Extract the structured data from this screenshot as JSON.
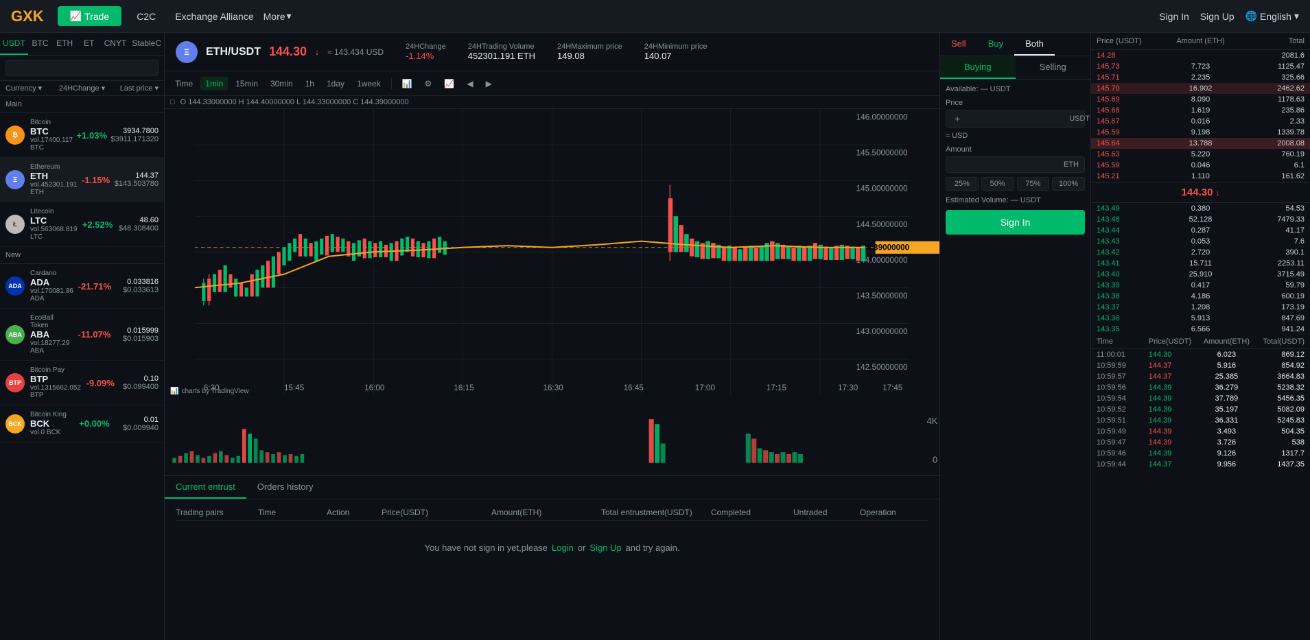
{
  "header": {
    "logo": "GXK",
    "nav": {
      "trade": "Trade",
      "c2c": "C2C",
      "exchange_alliance": "Exchange Alliance",
      "more": "More"
    },
    "right": {
      "sign_in": "Sign In",
      "sign_up": "Sign Up",
      "language": "English"
    }
  },
  "sidebar": {
    "tabs": [
      "USDT",
      "BTC",
      "ETH",
      "ET",
      "CNYT",
      "StableC"
    ],
    "active_tab": "USDT",
    "search_placeholder": "",
    "col_headers": [
      "Currency",
      "24HChange",
      "Last price"
    ],
    "section_main": "Main",
    "section_new": "New",
    "coins": [
      {
        "name": "Bitcoin",
        "ticker": "BTC",
        "change": "+1.03%",
        "change_type": "pos",
        "price1": "3934.7800",
        "price2": "$3911.171320",
        "vol": "vol.17400.117 BTC",
        "color": "#f7931a"
      },
      {
        "name": "Ethereum",
        "ticker": "ETH",
        "change": "-1.15%",
        "change_type": "neg",
        "price1": "144.37",
        "price2": "$143.503780",
        "vol": "vol.452301.191 ETH",
        "color": "#627eea"
      },
      {
        "name": "Litecoin",
        "ticker": "LTC",
        "change": "+2.52%",
        "change_type": "pos",
        "price1": "48.60",
        "price2": "$48.308400",
        "vol": "vol.563068.819 LTC",
        "color": "#bfbbbb"
      }
    ],
    "new_coins": [
      {
        "name": "Cardano",
        "ticker": "ADA",
        "change": "-21.71%",
        "change_type": "neg",
        "price1": "0.033816",
        "price2": "$0.033613",
        "vol": "vol.170081.86 ADA",
        "color": "#0033ad"
      },
      {
        "name": "EcoBall Token",
        "ticker": "ABA",
        "change": "-11.07%",
        "change_type": "neg",
        "price1": "0.015999",
        "price2": "$0.015903",
        "vol": "vol.18277.29 ABA",
        "color": "#4caf50"
      },
      {
        "name": "Bitcoin Pay",
        "ticker": "BTP",
        "change": "-9.09%",
        "change_type": "neg",
        "price1": "0.10",
        "price2": "$0.099400",
        "vol": "vol.1315662.052 BTP",
        "color": "#e84142"
      },
      {
        "name": "Bitcoin King",
        "ticker": "BCK",
        "change": "+0.00%",
        "change_type": "pos",
        "price1": "0.01",
        "price2": "$0.009940",
        "vol": "vol.0 BCK",
        "color": "#f5a623"
      }
    ]
  },
  "chart_header": {
    "pair": "ETH/USDT",
    "price": "144.30",
    "price_arrow": "↓",
    "approx": "≈ 143.434 USD",
    "stats": {
      "change_label": "24HChange",
      "change_val": "-1.14%",
      "vol_label": "24HTrading Volume",
      "vol_val": "452301.191 ETH",
      "max_label": "24HMaximum price",
      "max_val": "149.08",
      "min_label": "24HMinimum price",
      "min_val": "140.07"
    }
  },
  "chart_toolbar": {
    "time_label": "Time",
    "intervals": [
      "1min",
      "15min",
      "30min",
      "1h",
      "1day",
      "1week"
    ],
    "active_interval": "1min",
    "ohlc": "O 144.33000000  H 144.40000000  L 144.33000000  C 144.39000000"
  },
  "trade_form": {
    "tabs": [
      "Sell",
      "Buy",
      "Both"
    ],
    "active_tab": "Both",
    "buying_label": "Buying",
    "selling_label": "Selling",
    "active_side": "Buying",
    "available_label": "Available:",
    "available_val": "— USDT",
    "price_label": "Price",
    "price_unit": "USDT",
    "approx_label": "≈ USD",
    "amount_label": "Amount",
    "amount_unit": "ETH",
    "pct_btns": [
      "25%",
      "50%",
      "75%",
      "100%"
    ],
    "est_label": "Estimated Volume:",
    "est_val": "— USDT",
    "sign_in_btn": "Sign In"
  },
  "order_book": {
    "col_headers": [
      "Price (USDT)",
      "Amount (ETH)",
      "Total"
    ],
    "asks": [
      {
        "price": "145.73",
        "amount": "7.723",
        "total": "1125.47"
      },
      {
        "price": "145.71",
        "amount": "2.235",
        "total": "325.66"
      },
      {
        "price": "145.70",
        "amount": "16.902",
        "total": "2462.62"
      },
      {
        "price": "145.69",
        "amount": "8.090",
        "total": "1178.63"
      },
      {
        "price": "145.68",
        "amount": "1.619",
        "total": "235.86"
      },
      {
        "price": "145.67",
        "amount": "0.016",
        "total": "2.33"
      },
      {
        "price": "145.59",
        "amount": "9.198",
        "total": "1339.78"
      },
      {
        "price": "145.64",
        "amount": "13.788",
        "total": "2008.08"
      },
      {
        "price": "145.63",
        "amount": "5.220",
        "total": "760.19"
      },
      {
        "price": "145.59",
        "amount": "0.046",
        "total": "6.1"
      },
      {
        "price": "145.21",
        "amount": "1.110",
        "total": "161.62"
      },
      {
        "price": "14.28",
        "amount": "",
        "total": "2081.6"
      }
    ],
    "mid_price": "144.30",
    "mid_arrow": "↓",
    "bids": [
      {
        "price": "143.49",
        "amount": "0.380",
        "total": "54.53"
      },
      {
        "price": "143.48",
        "amount": "52.128",
        "total": "7479.33"
      },
      {
        "price": "143.44",
        "amount": "0.287",
        "total": "41.17"
      },
      {
        "price": "143.43",
        "amount": "0.053",
        "total": "7.6"
      },
      {
        "price": "143.42",
        "amount": "2.720",
        "total": "390.1"
      },
      {
        "price": "143.41",
        "amount": "15.711",
        "total": "2253.11"
      },
      {
        "price": "143.40",
        "amount": "25.910",
        "total": "3715.49"
      },
      {
        "price": "143.39",
        "amount": "0.417",
        "total": "59.79"
      },
      {
        "price": "143.38",
        "amount": "4.186",
        "total": "600.19"
      },
      {
        "price": "143.37",
        "amount": "1.208",
        "total": "173.19"
      },
      {
        "price": "143.36",
        "amount": "5.913",
        "total": "847.69"
      },
      {
        "price": "143.35",
        "amount": "6.566",
        "total": "941.24"
      }
    ],
    "trade_history_headers": [
      "Time",
      "Price(USDT)",
      "Amount(ETH)",
      "Total(USDT)"
    ],
    "trades": [
      {
        "time": "11:00:01",
        "price": "144.30",
        "amount": "6.023",
        "total": "869.12",
        "type": "buy"
      },
      {
        "time": "10:59:59",
        "price": "144.37",
        "amount": "5.916",
        "total": "854.92",
        "type": "sell"
      },
      {
        "time": "10:59:57",
        "price": "144.37",
        "amount": "25.385",
        "total": "3664.83",
        "type": "sell"
      },
      {
        "time": "10:59:56",
        "price": "144.39",
        "amount": "36.279",
        "total": "5238.32",
        "type": "buy"
      },
      {
        "time": "10:59:54",
        "price": "144.39",
        "amount": "37.789",
        "total": "5456.35",
        "type": "buy"
      },
      {
        "time": "10:59:52",
        "price": "144.39",
        "amount": "35.197",
        "total": "5082.09",
        "type": "buy"
      },
      {
        "time": "10:59:51",
        "price": "144.39",
        "amount": "36.331",
        "total": "5245.83",
        "type": "buy"
      },
      {
        "time": "10:59:49",
        "price": "144.39",
        "amount": "3.493",
        "total": "504.35",
        "type": "sell"
      },
      {
        "time": "10:59:47",
        "price": "144.39",
        "amount": "3.726",
        "total": "538",
        "type": "sell"
      },
      {
        "time": "10:59:46",
        "price": "144.39",
        "amount": "9.126",
        "total": "1317.7",
        "type": "buy"
      },
      {
        "time": "10:59:44",
        "price": "144.37",
        "amount": "9.956",
        "total": "1437.35",
        "type": "buy"
      }
    ]
  },
  "bottom": {
    "tabs": [
      "Current entrust",
      "Orders history"
    ],
    "active_tab": "Current entrust",
    "table_headers": [
      "Trading pairs",
      "Time",
      "Action",
      "Price(USDT)",
      "Amount(ETH)",
      "Total entrustment(USDT)",
      "Completed",
      "Untraded",
      "Operation"
    ],
    "empty_msg": "You have not sign in yet,please",
    "login_link": "Login",
    "or_text": "or",
    "signup_link": "Sign Up",
    "try_text": "and try again."
  },
  "colors": {
    "buy": "#00b96b",
    "sell": "#f85149",
    "accent": "#f5a623",
    "bg": "#0d1117",
    "panel": "#161b22",
    "border": "#21262d",
    "text_muted": "#8b949e",
    "text_main": "#e6edf3"
  }
}
